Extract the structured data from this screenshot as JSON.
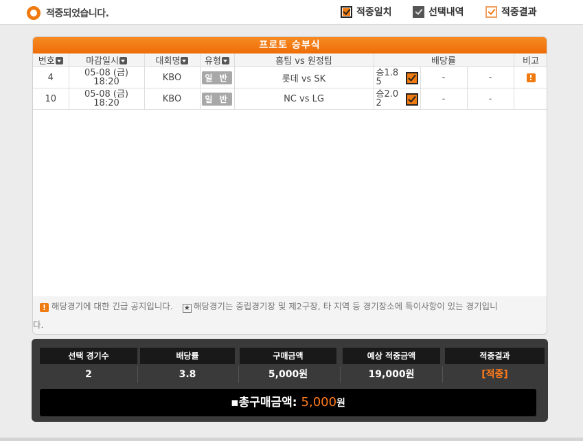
{
  "header": {
    "status_text": "적중되었습니다.",
    "legend": [
      {
        "label": "적중일치"
      },
      {
        "label": "선택내역"
      },
      {
        "label": "적중결과"
      }
    ]
  },
  "panel": {
    "title": "프로토 승부식",
    "columns": {
      "no": "번호",
      "deadline": "마감일시",
      "league": "대회명",
      "type": "유형",
      "teams": "홈팀 vs 원정팀",
      "odds": "배당률",
      "note": "비고"
    },
    "rows": [
      {
        "no": "4",
        "date": "05-08 (금)",
        "time": "18:20",
        "league": "KBO",
        "type": "일 반",
        "teams": "롯데 vs SK",
        "odds_text": "승1.8 5",
        "draw": "-",
        "lose": "-",
        "note_icon": "!"
      },
      {
        "no": "10",
        "date": "05-08 (금)",
        "time": "18:20",
        "league": "KBO",
        "type": "일 반",
        "teams": "NC vs LG",
        "odds_text": "승2.0 2",
        "draw": "-",
        "lose": "-",
        "note_icon": ""
      }
    ],
    "notice": {
      "urgent_icon": "!",
      "urgent_text": "해당경기에 대한 긴급 공지입니다.",
      "star_icon": "★",
      "star_text": "해당경기는 중립경기장 및 제2구장, 타 지역 등 경기장소에 특이사항이 있는 경기입니",
      "star_text_cont": "다."
    }
  },
  "summary": {
    "headers": [
      "선택 경기수",
      "배당률",
      "구매금액",
      "예상 적중금액",
      "적중결과"
    ],
    "values": [
      "2",
      "3.8",
      "5,000원",
      "19,000원",
      "[적중]"
    ],
    "total_label": "▪총구매금액: ",
    "total_amount": "5,000",
    "total_unit": "원"
  },
  "colors": {
    "accent": "#f07a10",
    "summary_bg": "#3a3a3a"
  }
}
